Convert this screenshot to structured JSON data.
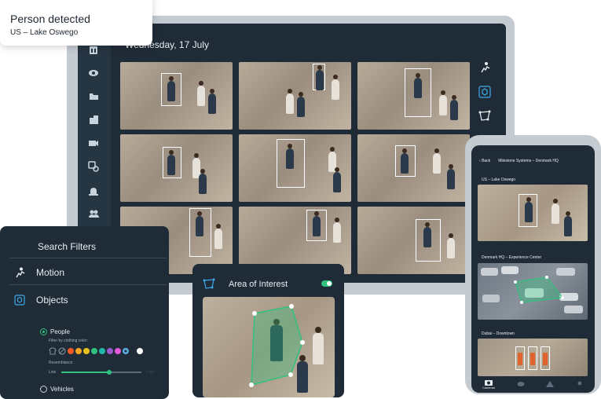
{
  "notification": {
    "title": "Person detected",
    "location": "US – Lake Oswego"
  },
  "main": {
    "date": "Wednesday, 17 July",
    "sidebar_icons": [
      "grid-icon",
      "eye-icon",
      "folder-icon",
      "building-icon",
      "camera-icon",
      "rules-icon",
      "alarm-icon",
      "users-icon"
    ],
    "right_tools": [
      "motion-icon",
      "object-icon",
      "area-icon"
    ]
  },
  "filters": {
    "title": "Search Filters",
    "motion_label": "Motion",
    "objects_label": "Objects",
    "people_label": "People",
    "clothing_label": "Filter by clothing color:",
    "resemblance_label": "Resemblance",
    "low_label": "Low",
    "high_label": "High",
    "vehicles_label": "Vehicles",
    "resemblance_value": 0.6,
    "swatch_colors": [
      "#f05a28",
      "#f6a623",
      "#e8c21c",
      "#2ec27e",
      "#1fb5a8",
      "#9b59d0",
      "#e25ad8",
      "#5fb4e8",
      "#ffffff"
    ]
  },
  "aoi": {
    "title": "Area of Interest",
    "enabled": true
  },
  "phone": {
    "back_label": "Back",
    "site_title": "Milestone Systems – Denmark HQ",
    "cameras": [
      {
        "label": "US – Lake Oswego"
      },
      {
        "label": "Denmark HQ – Experience Center"
      },
      {
        "label": "Dubai – Downtown"
      }
    ],
    "nav": [
      "Cameras",
      "",
      "",
      ""
    ]
  }
}
